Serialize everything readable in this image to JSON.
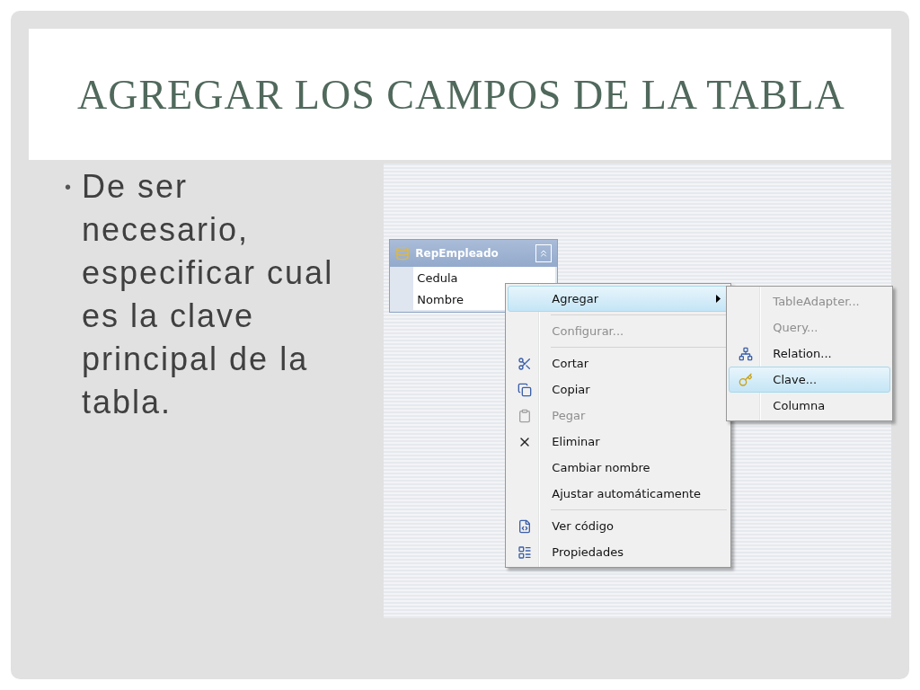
{
  "title": "AGREGAR LOS CAMPOS DE LA TABLA",
  "bullets": [
    {
      "marker": "•",
      "text": "De ser necesario, especificar cual es la clave principal de la tabla."
    }
  ],
  "table": {
    "name": "RepEmpleado",
    "fields": [
      "Cedula",
      "Nombre"
    ]
  },
  "context_menu": [
    {
      "kind": "item",
      "label": "Agregar",
      "selected": true,
      "disabled": false,
      "submenu": true
    },
    {
      "kind": "separator"
    },
    {
      "kind": "item",
      "label": "Configurar...",
      "selected": false,
      "disabled": true,
      "submenu": false
    },
    {
      "kind": "separator"
    },
    {
      "kind": "item",
      "label": "Cortar",
      "selected": false,
      "disabled": false,
      "submenu": false
    },
    {
      "kind": "item",
      "label": "Copiar",
      "selected": false,
      "disabled": false,
      "submenu": false
    },
    {
      "kind": "item",
      "label": "Pegar",
      "selected": false,
      "disabled": true,
      "submenu": false
    },
    {
      "kind": "item",
      "label": "Eliminar",
      "selected": false,
      "disabled": false,
      "submenu": false
    },
    {
      "kind": "item",
      "label": "Cambiar nombre",
      "selected": false,
      "disabled": false,
      "submenu": false
    },
    {
      "kind": "item",
      "label": "Ajustar automáticamente",
      "selected": false,
      "disabled": false,
      "submenu": false
    },
    {
      "kind": "separator"
    },
    {
      "kind": "item",
      "label": "Ver código",
      "selected": false,
      "disabled": false,
      "submenu": false
    },
    {
      "kind": "item",
      "label": "Propiedades",
      "selected": false,
      "disabled": false,
      "submenu": false
    }
  ],
  "submenu": [
    {
      "kind": "item",
      "label": "TableAdapter...",
      "selected": false,
      "disabled": true
    },
    {
      "kind": "item",
      "label": "Query...",
      "selected": false,
      "disabled": true
    },
    {
      "kind": "item",
      "label": "Relation...",
      "selected": false,
      "disabled": false
    },
    {
      "kind": "item",
      "label": "Clave...",
      "selected": true,
      "disabled": false
    },
    {
      "kind": "item",
      "label": "Columna",
      "selected": false,
      "disabled": false
    }
  ]
}
